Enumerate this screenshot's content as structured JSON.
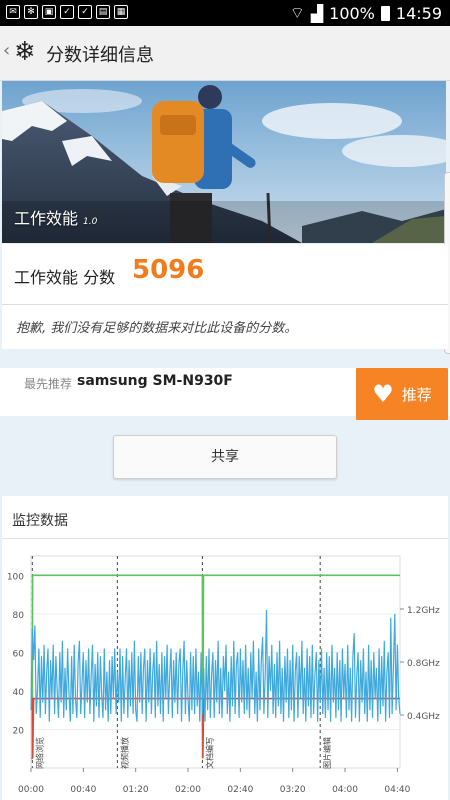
{
  "status_bar": {
    "icons_left": [
      "mail-icon",
      "snowflake-icon",
      "image-icon",
      "check-bag-icon",
      "check-bag-icon",
      "image-bag-icon",
      "sd-card-icon"
    ],
    "battery": "100%",
    "time": "14:59"
  },
  "app_bar": {
    "title": "分数详细信息"
  },
  "hero": {
    "title": "工作效能",
    "version": "1.0"
  },
  "score": {
    "label": "工作效能 分数",
    "value": "5096"
  },
  "notice": "抱歉, 我们没有足够的数据来对比此设备的分数。",
  "recommend": {
    "prefix": "最先推荐",
    "device": "samsung SM-N930F",
    "button": "推荐"
  },
  "share_button": "共享",
  "monitor": {
    "title": "监控数据"
  },
  "chart_data": {
    "type": "line",
    "x_ticks": [
      "00:00",
      "00:40",
      "01:20",
      "02:00",
      "02:40",
      "03:20",
      "04:00",
      "04:40"
    ],
    "y_left_ticks": [
      "100",
      "80",
      "60",
      "40",
      "20"
    ],
    "y_left_range": [
      0,
      110
    ],
    "y_right_ticks": [
      "1.2GHz",
      "0.8GHz",
      "0.4GHz"
    ],
    "y_right_range": [
      0,
      1.6
    ],
    "x_range_seconds": [
      0,
      282
    ],
    "sections": [
      {
        "label": "网络浏览",
        "start": 1
      },
      {
        "label": "视频播放",
        "start": 66
      },
      {
        "label": "文档编写",
        "start": 131
      },
      {
        "label": "图片编辑",
        "start": 221
      }
    ],
    "series": [
      {
        "color": "#5cc15e",
        "values": [
          [
            0,
            5
          ],
          [
            1,
            5
          ],
          [
            1.2,
            100
          ],
          [
            131,
            100
          ],
          [
            131.2,
            5
          ],
          [
            131.8,
            100
          ],
          [
            282,
            100
          ]
        ]
      },
      {
        "color": "#d84b3a",
        "values": [
          [
            0,
            36
          ],
          [
            1,
            36
          ],
          [
            1.3,
            5
          ],
          [
            2,
            36
          ],
          [
            131,
            36
          ],
          [
            131.3,
            5
          ],
          [
            132,
            36
          ],
          [
            282,
            36
          ]
        ]
      },
      {
        "color": "#3fa9dc",
        "values": [
          [
            0,
            30
          ],
          [
            1,
            72
          ],
          [
            2,
            56
          ],
          [
            3,
            74
          ],
          [
            4,
            28
          ],
          [
            5,
            40
          ],
          [
            6,
            62
          ],
          [
            7,
            26
          ],
          [
            8,
            58
          ],
          [
            9,
            34
          ],
          [
            10,
            64
          ],
          [
            11,
            28
          ],
          [
            12,
            50
          ],
          [
            13,
            62
          ],
          [
            14,
            24
          ],
          [
            15,
            56
          ],
          [
            16,
            36
          ],
          [
            17,
            64
          ],
          [
            18,
            28
          ],
          [
            19,
            58
          ],
          [
            20,
            40
          ],
          [
            21,
            26
          ],
          [
            22,
            60
          ],
          [
            23,
            34
          ],
          [
            24,
            66
          ],
          [
            25,
            26
          ],
          [
            26,
            52
          ],
          [
            27,
            30
          ],
          [
            28,
            62
          ],
          [
            29,
            40
          ],
          [
            30,
            24
          ],
          [
            31,
            58
          ],
          [
            32,
            28
          ],
          [
            33,
            64
          ],
          [
            34,
            36
          ],
          [
            35,
            26
          ],
          [
            36,
            54
          ],
          [
            37,
            66
          ],
          [
            38,
            28
          ],
          [
            39,
            44
          ],
          [
            40,
            60
          ],
          [
            41,
            26
          ],
          [
            42,
            56
          ],
          [
            43,
            34
          ],
          [
            44,
            62
          ],
          [
            45,
            28
          ],
          [
            46,
            48
          ],
          [
            47,
            64
          ],
          [
            48,
            24
          ],
          [
            49,
            54
          ],
          [
            50,
            32
          ],
          [
            51,
            60
          ],
          [
            52,
            26
          ],
          [
            53,
            58
          ],
          [
            54,
            38
          ],
          [
            55,
            26
          ],
          [
            56,
            62
          ],
          [
            57,
            30
          ],
          [
            58,
            50
          ],
          [
            59,
            24
          ],
          [
            60,
            56
          ],
          [
            61,
            28
          ],
          [
            62,
            58
          ],
          [
            63,
            36
          ],
          [
            64,
            62
          ],
          [
            65,
            28
          ],
          [
            66,
            50
          ],
          [
            67,
            34
          ],
          [
            68,
            62
          ],
          [
            69,
            24
          ],
          [
            70,
            58
          ],
          [
            71,
            28
          ],
          [
            72,
            46
          ],
          [
            73,
            62
          ],
          [
            74,
            26
          ],
          [
            75,
            56
          ],
          [
            76,
            32
          ],
          [
            77,
            60
          ],
          [
            78,
            28
          ],
          [
            79,
            66
          ],
          [
            80,
            30
          ],
          [
            81,
            24
          ],
          [
            82,
            58
          ],
          [
            83,
            34
          ],
          [
            84,
            60
          ],
          [
            85,
            28
          ],
          [
            86,
            52
          ],
          [
            87,
            62
          ],
          [
            88,
            24
          ],
          [
            89,
            56
          ],
          [
            90,
            34
          ],
          [
            91,
            62
          ],
          [
            92,
            28
          ],
          [
            93,
            50
          ],
          [
            94,
            60
          ],
          [
            95,
            26
          ],
          [
            96,
            66
          ],
          [
            97,
            32
          ],
          [
            98,
            54
          ],
          [
            99,
            28
          ],
          [
            100,
            60
          ],
          [
            101,
            24
          ],
          [
            102,
            58
          ],
          [
            103,
            36
          ],
          [
            104,
            64
          ],
          [
            105,
            28
          ],
          [
            106,
            48
          ],
          [
            107,
            62
          ],
          [
            108,
            26
          ],
          [
            109,
            56
          ],
          [
            110,
            34
          ],
          [
            111,
            60
          ],
          [
            112,
            28
          ],
          [
            113,
            54
          ],
          [
            114,
            62
          ],
          [
            115,
            24
          ],
          [
            116,
            50
          ],
          [
            117,
            66
          ],
          [
            118,
            28
          ],
          [
            119,
            56
          ],
          [
            120,
            36
          ],
          [
            121,
            24
          ],
          [
            122,
            60
          ],
          [
            123,
            30
          ],
          [
            124,
            58
          ],
          [
            125,
            28
          ],
          [
            126,
            62
          ],
          [
            127,
            32
          ],
          [
            128,
            50
          ],
          [
            129,
            24
          ],
          [
            130,
            60
          ],
          [
            131,
            28
          ],
          [
            132,
            52
          ],
          [
            133,
            24
          ],
          [
            134,
            58
          ],
          [
            135,
            30
          ],
          [
            136,
            62
          ],
          [
            137,
            26
          ],
          [
            138,
            48
          ],
          [
            139,
            60
          ],
          [
            140,
            26
          ],
          [
            141,
            56
          ],
          [
            142,
            34
          ],
          [
            143,
            66
          ],
          [
            144,
            28
          ],
          [
            145,
            52
          ],
          [
            146,
            26
          ],
          [
            147,
            58
          ],
          [
            148,
            40
          ],
          [
            149,
            64
          ],
          [
            150,
            28
          ],
          [
            151,
            50
          ],
          [
            152,
            24
          ],
          [
            153,
            58
          ],
          [
            154,
            32
          ],
          [
            155,
            66
          ],
          [
            156,
            28
          ],
          [
            157,
            54
          ],
          [
            158,
            60
          ],
          [
            159,
            26
          ],
          [
            160,
            62
          ],
          [
            161,
            34
          ],
          [
            162,
            56
          ],
          [
            163,
            28
          ],
          [
            164,
            64
          ],
          [
            165,
            30
          ],
          [
            166,
            52
          ],
          [
            167,
            26
          ],
          [
            168,
            60
          ],
          [
            169,
            36
          ],
          [
            170,
            66
          ],
          [
            171,
            28
          ],
          [
            172,
            50
          ],
          [
            173,
            24
          ],
          [
            174,
            62
          ],
          [
            175,
            30
          ],
          [
            176,
            56
          ],
          [
            177,
            68
          ],
          [
            178,
            28
          ],
          [
            179,
            48
          ],
          [
            180,
            82
          ],
          [
            181,
            26
          ],
          [
            182,
            58
          ],
          [
            183,
            40
          ],
          [
            184,
            64
          ],
          [
            185,
            28
          ],
          [
            186,
            54
          ],
          [
            187,
            26
          ],
          [
            188,
            60
          ],
          [
            189,
            32
          ],
          [
            190,
            66
          ],
          [
            191,
            28
          ],
          [
            192,
            52
          ],
          [
            193,
            24
          ],
          [
            194,
            58
          ],
          [
            195,
            34
          ],
          [
            196,
            62
          ],
          [
            197,
            26
          ],
          [
            198,
            56
          ],
          [
            199,
            30
          ],
          [
            200,
            64
          ],
          [
            201,
            24
          ],
          [
            202,
            50
          ],
          [
            203,
            60
          ],
          [
            204,
            26
          ],
          [
            205,
            58
          ],
          [
            206,
            36
          ],
          [
            207,
            66
          ],
          [
            208,
            28
          ],
          [
            209,
            52
          ],
          [
            210,
            24
          ],
          [
            211,
            62
          ],
          [
            212,
            32
          ],
          [
            213,
            58
          ],
          [
            214,
            26
          ],
          [
            215,
            64
          ],
          [
            216,
            28
          ],
          [
            217,
            48
          ],
          [
            218,
            60
          ],
          [
            219,
            24
          ],
          [
            220,
            56
          ],
          [
            221,
            34
          ],
          [
            222,
            62
          ],
          [
            223,
            28
          ],
          [
            224,
            52
          ],
          [
            225,
            26
          ],
          [
            226,
            60
          ],
          [
            227,
            30
          ],
          [
            228,
            58
          ],
          [
            229,
            24
          ],
          [
            230,
            64
          ],
          [
            231,
            34
          ],
          [
            232,
            52
          ],
          [
            233,
            26
          ],
          [
            234,
            60
          ],
          [
            235,
            30
          ],
          [
            236,
            56
          ],
          [
            237,
            24
          ],
          [
            238,
            62
          ],
          [
            239,
            36
          ],
          [
            240,
            54
          ],
          [
            241,
            26
          ],
          [
            242,
            64
          ],
          [
            243,
            30
          ],
          [
            244,
            52
          ],
          [
            245,
            24
          ],
          [
            246,
            58
          ],
          [
            247,
            70
          ],
          [
            248,
            26
          ],
          [
            249,
            48
          ],
          [
            250,
            60
          ],
          [
            251,
            24
          ],
          [
            252,
            56
          ],
          [
            253,
            34
          ],
          [
            254,
            62
          ],
          [
            255,
            28
          ],
          [
            256,
            50
          ],
          [
            257,
            24
          ],
          [
            258,
            64
          ],
          [
            259,
            30
          ],
          [
            260,
            56
          ],
          [
            261,
            26
          ],
          [
            262,
            60
          ],
          [
            263,
            36
          ],
          [
            264,
            52
          ],
          [
            265,
            24
          ],
          [
            266,
            62
          ],
          [
            267,
            28
          ],
          [
            268,
            58
          ],
          [
            269,
            32
          ],
          [
            270,
            66
          ],
          [
            271,
            24
          ],
          [
            272,
            50
          ],
          [
            273,
            60
          ],
          [
            274,
            26
          ],
          [
            275,
            78
          ],
          [
            276,
            28
          ],
          [
            277,
            54
          ],
          [
            278,
            80
          ],
          [
            279,
            30
          ],
          [
            280,
            64
          ],
          [
            281,
            36
          ],
          [
            282,
            28
          ]
        ]
      }
    ]
  }
}
